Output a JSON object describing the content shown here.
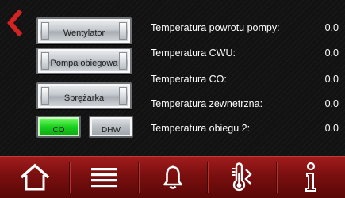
{
  "controls": {
    "fan_label": "Wentylator",
    "pump_label": "Pompa obiegowa",
    "compressor_label": "Sprężarka",
    "mode_co_label": "CO",
    "mode_dhw_label": "DHW"
  },
  "readings": [
    {
      "label": "Temperatura powrotu pompy:",
      "value": "0.0"
    },
    {
      "label": "Temperatura CWU:",
      "value": "0.0"
    },
    {
      "label": "Temperatura CO:",
      "value": "0.0"
    },
    {
      "label": "Temperatura zewnetrzna:",
      "value": "0.0"
    },
    {
      "label": "Temperatura obiegu 2:",
      "value": "0.0"
    }
  ],
  "colors": {
    "accent_red": "#d32323",
    "active_green": "#19d11e",
    "nav_bar": "#7a0f0f"
  },
  "icons": {
    "back": "chevron-left-icon",
    "home": "home-icon",
    "menu": "menu-icon",
    "alarms": "bell-icon",
    "temperature": "thermometer-icon",
    "info": "info-icon"
  }
}
